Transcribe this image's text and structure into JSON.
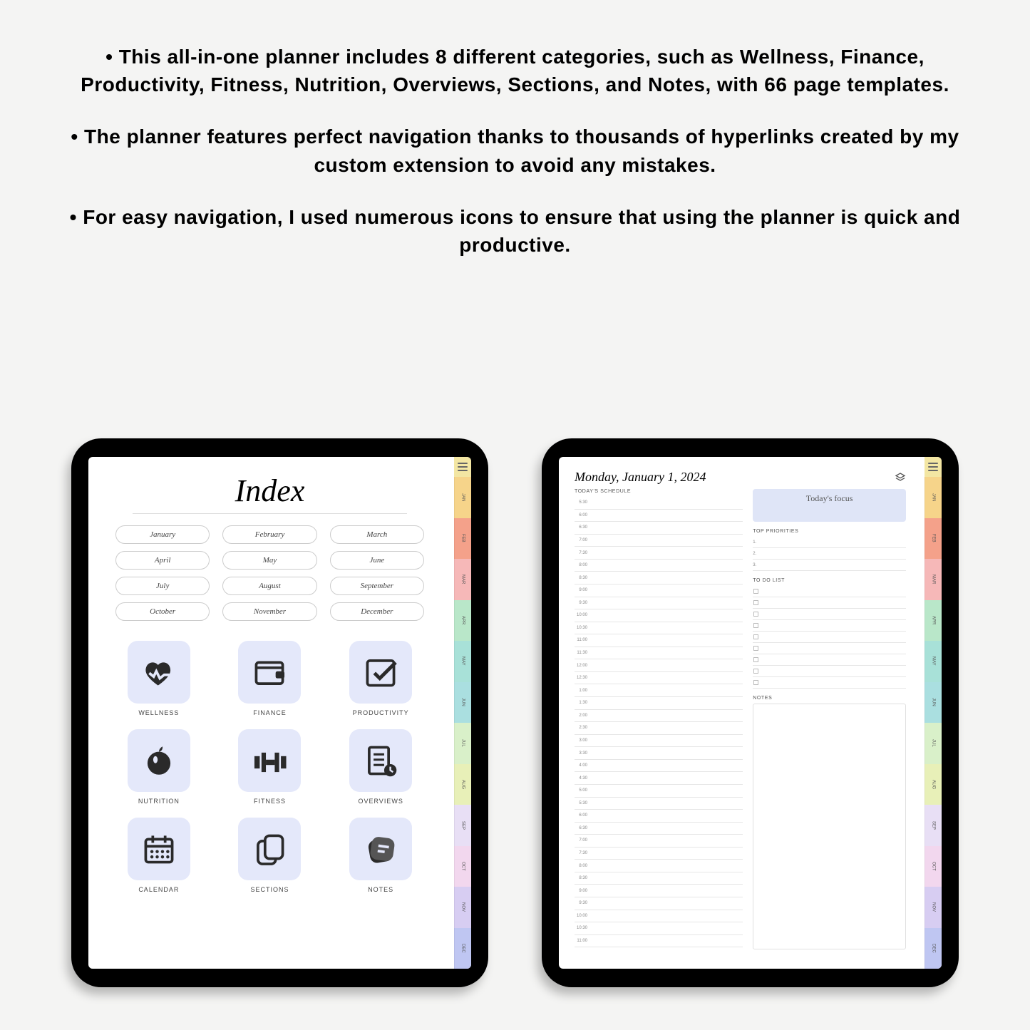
{
  "bullets": [
    "• This all-in-one planner includes 8 different categories, such as Wellness, Finance, Productivity, Fitness, Nutrition, Overviews, Sections, and Notes, with 66 page templates.",
    "• The planner features perfect navigation thanks to thousands of hyperlinks created by my custom extension to avoid any mistakes.",
    "• For easy navigation, I used numerous icons to ensure that using the planner is quick and productive."
  ],
  "tabs": [
    {
      "label": "JAN",
      "color": "#f6d48a"
    },
    {
      "label": "FEB",
      "color": "#f4a18a"
    },
    {
      "label": "MAR",
      "color": "#f6b8b8"
    },
    {
      "label": "APR",
      "color": "#b9e7c9"
    },
    {
      "label": "MAY",
      "color": "#a8e1d8"
    },
    {
      "label": "JUN",
      "color": "#aadfe0"
    },
    {
      "label": "JUL",
      "color": "#d9f0c9"
    },
    {
      "label": "AUG",
      "color": "#e8f0b8"
    },
    {
      "label": "SEP",
      "color": "#e8dff5"
    },
    {
      "label": "OCT",
      "color": "#f2d7ee"
    },
    {
      "label": "NOV",
      "color": "#d7cdf2"
    },
    {
      "label": "DEC",
      "color": "#bfc6f2"
    }
  ],
  "hamburger_color": "#f3e6a3",
  "index": {
    "title": "Index",
    "months": [
      "January",
      "February",
      "March",
      "April",
      "May",
      "June",
      "July",
      "August",
      "September",
      "October",
      "November",
      "December"
    ],
    "categories": [
      {
        "label": "WELLNESS",
        "icon": "heart"
      },
      {
        "label": "FINANCE",
        "icon": "wallet"
      },
      {
        "label": "PRODUCTIVITY",
        "icon": "check"
      },
      {
        "label": "NUTRITION",
        "icon": "apple"
      },
      {
        "label": "FITNESS",
        "icon": "dumbbell"
      },
      {
        "label": "OVERVIEWS",
        "icon": "doc"
      },
      {
        "label": "CALENDAR",
        "icon": "calendar"
      },
      {
        "label": "SECTIONS",
        "icon": "sections"
      },
      {
        "label": "NOTES",
        "icon": "note"
      }
    ]
  },
  "daily": {
    "title": "Monday, January 1, 2024",
    "schedule_h": "TODAY'S SCHEDULE",
    "focus": "Today's focus",
    "prio_h": "TOP PRIORITIES",
    "pri_nums": [
      "1.",
      "2.",
      "3."
    ],
    "todo_h": "TO DO LIST",
    "todo_count": 9,
    "notes_h": "NOTES",
    "times": [
      "5:30",
      "6:00",
      "6:30",
      "7:00",
      "7:30",
      "8:00",
      "8:30",
      "9:00",
      "9:30",
      "10:00",
      "10:30",
      "11:00",
      "11:30",
      "12:00",
      "12:30",
      "1:00",
      "1:30",
      "2:00",
      "2:30",
      "3:00",
      "3:30",
      "4:00",
      "4:30",
      "5:00",
      "5:30",
      "6:00",
      "6:30",
      "7:00",
      "7:30",
      "8:00",
      "8:30",
      "9:00",
      "9:30",
      "10:00",
      "10:30",
      "11:00"
    ]
  }
}
